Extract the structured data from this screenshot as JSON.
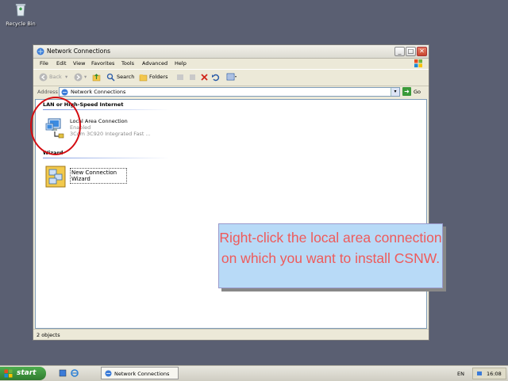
{
  "desktop": {
    "recycle_bin_label": "Recycle Bin"
  },
  "window": {
    "title": "Network Connections",
    "controls": {
      "minimize": "_",
      "maximize": "□",
      "close": "✕"
    }
  },
  "menu": [
    "File",
    "Edit",
    "View",
    "Favorites",
    "Tools",
    "Advanced",
    "Help"
  ],
  "toolbar": {
    "back": "Back",
    "search": "Search",
    "folders": "Folders"
  },
  "address": {
    "label": "Address",
    "value": "Network Connections",
    "go": "Go"
  },
  "content": {
    "group1": {
      "title": "LAN or High-Speed Internet"
    },
    "connection": {
      "name": "Local Area Connection",
      "status": "Enabled",
      "device": "3Com 3C920 Integrated Fast ..."
    },
    "group2": {
      "title": "Wizard"
    },
    "wizard": {
      "name": "New Connection Wizard"
    }
  },
  "status_bar": {
    "text": "2 objects"
  },
  "callout": {
    "text": "Right-click the local area connection on which you want to install CSNW."
  },
  "taskbar": {
    "start": "start",
    "task_label": "Network Connections",
    "language": "EN",
    "clock": "16:08"
  }
}
